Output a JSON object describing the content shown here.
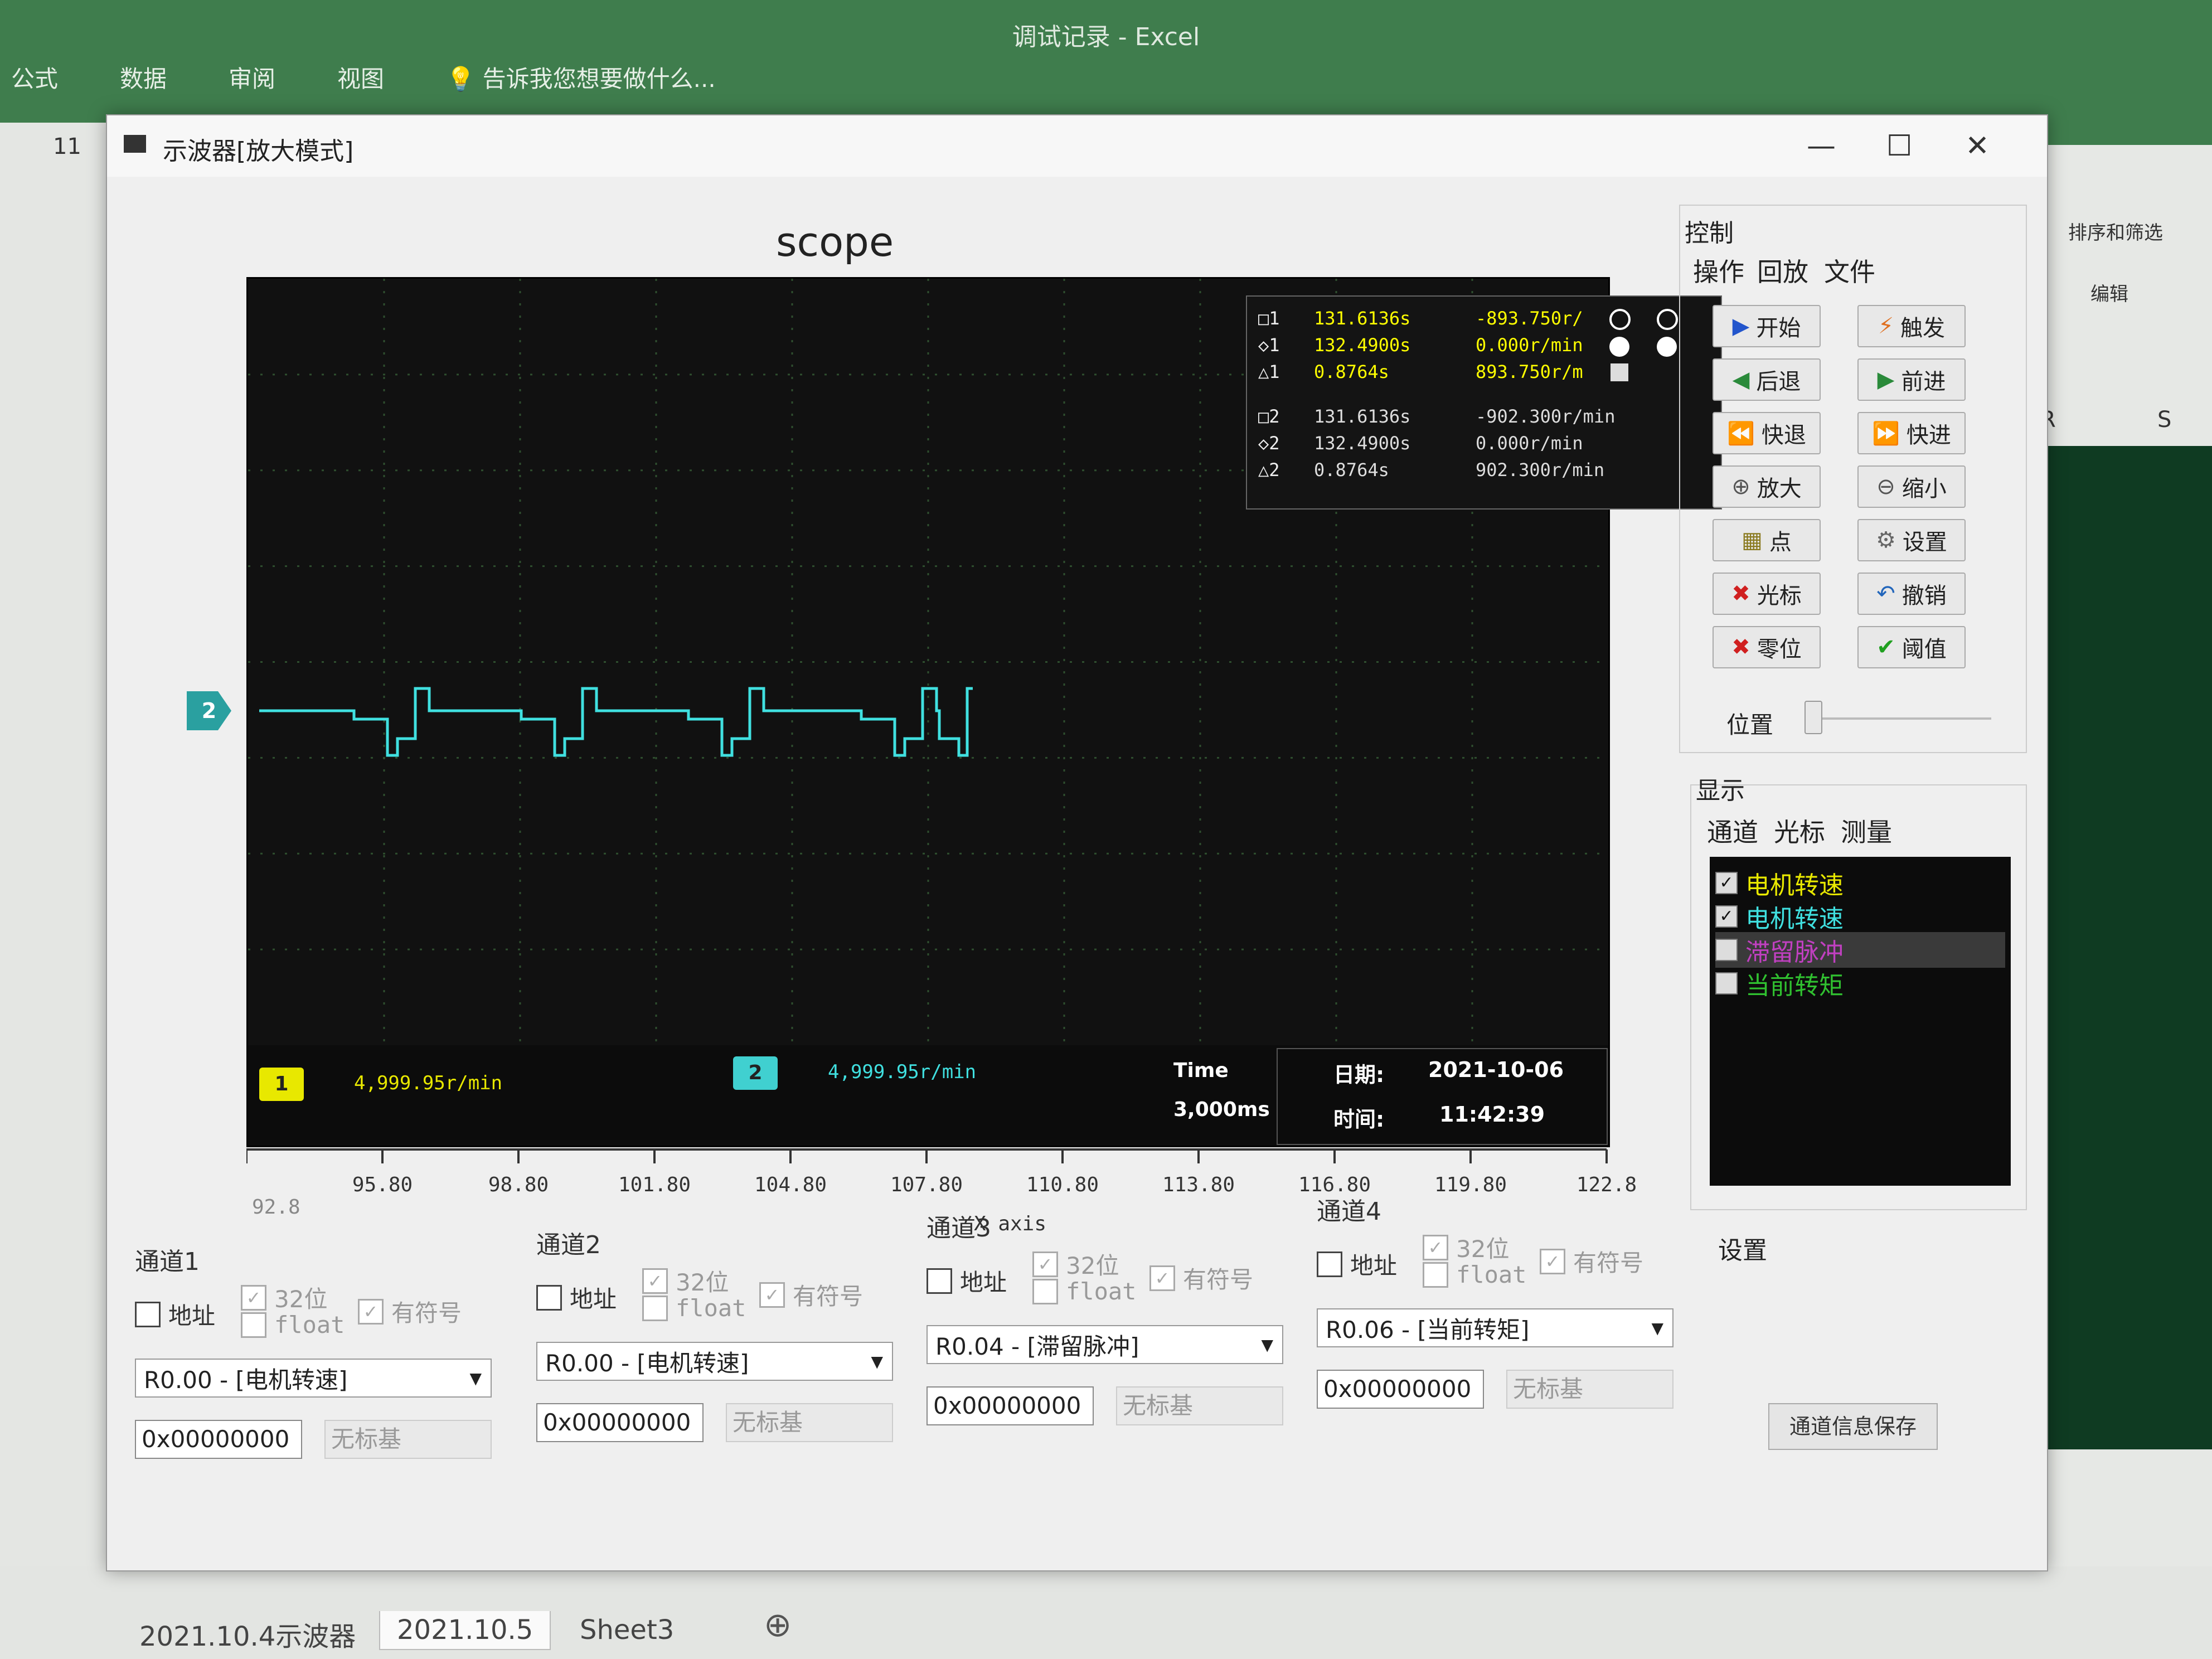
{
  "excel": {
    "title": "调试记录 - Excel",
    "ribbon_tabs": [
      "公式",
      "数据",
      "审阅",
      "视图"
    ],
    "tell_me": "告诉我您想要做什么...",
    "font_size": "11",
    "sort_filter": "排序和筛选",
    "edit_group": "编辑",
    "col_r": "R",
    "col_s": "S",
    "sheet_tabs": [
      "2021.10.4示波器",
      "2021.10.5",
      "Sheet3"
    ]
  },
  "window": {
    "title": "示波器[放大模式]",
    "minimize": "—",
    "maximize": "☐",
    "close": "✕"
  },
  "scope": {
    "title": "scope",
    "channel_marker": "2",
    "cursors": [
      {
        "sym": "□1",
        "t": "131.6136s",
        "v": "-893.750r/"
      },
      {
        "sym": "◇1",
        "t": "132.4900s",
        "v": "0.000r/min"
      },
      {
        "sym": "△1",
        "t": "0.8764s",
        "v": "893.750r/m"
      },
      {
        "sym": "□2",
        "t": "131.6136s",
        "v": "-902.300r/min"
      },
      {
        "sym": "◇2",
        "t": "132.4900s",
        "v": "0.000r/min"
      },
      {
        "sym": "△2",
        "t": "0.8764s",
        "v": "902.300r/min"
      }
    ],
    "status": {
      "ch1_badge": "1",
      "ch1_value": "4,999.95r/min",
      "ch2_badge": "2",
      "ch2_value": "4,999.95r/min",
      "time_label": "Time",
      "time_value": "3,000ms",
      "date_label": "日期:",
      "date_value": "2021-10-06",
      "clock_label": "时间:",
      "clock_value": "11:42:39"
    },
    "x_axis": {
      "title": "X axis",
      "ticks": [
        "92.8",
        "95.80",
        "98.80",
        "101.80",
        "104.80",
        "107.80",
        "110.80",
        "113.80",
        "116.80",
        "119.80",
        "122.8"
      ]
    }
  },
  "control": {
    "group_title": "控制",
    "tabs": [
      "操作",
      "回放",
      "文件"
    ],
    "buttons": [
      {
        "label": "开始",
        "icon": "play-icon",
        "glyph": "▶",
        "color": "#2255cc"
      },
      {
        "label": "触发",
        "icon": "trigger-icon",
        "glyph": "⚡",
        "color": "#e07020"
      },
      {
        "label": "后退",
        "icon": "back-icon",
        "glyph": "◀",
        "color": "#2a8a3a"
      },
      {
        "label": "前进",
        "icon": "forward-icon",
        "glyph": "▶",
        "color": "#2a8a3a"
      },
      {
        "label": "快退",
        "icon": "rewind-icon",
        "glyph": "⏪",
        "color": "#c8a020"
      },
      {
        "label": "快进",
        "icon": "fast-forward-icon",
        "glyph": "⏩",
        "color": "#c8a020"
      },
      {
        "label": "放大",
        "icon": "zoom-in-icon",
        "glyph": "⊕",
        "color": "#555"
      },
      {
        "label": "缩小",
        "icon": "zoom-out-icon",
        "glyph": "⊖",
        "color": "#555"
      },
      {
        "label": "点",
        "icon": "point-icon",
        "glyph": "▦",
        "color": "#8a7a20"
      },
      {
        "label": "设置",
        "icon": "settings-icon",
        "glyph": "⚙",
        "color": "#666"
      },
      {
        "label": "光标",
        "icon": "cursor-icon",
        "glyph": "✖",
        "color": "#d02020"
      },
      {
        "label": "撤销",
        "icon": "undo-icon",
        "glyph": "↶",
        "color": "#2266bb"
      },
      {
        "label": "零位",
        "icon": "zero-icon",
        "glyph": "✖",
        "color": "#d02020"
      },
      {
        "label": "阈值",
        "icon": "threshold-icon",
        "glyph": "✔",
        "color": "#20a020"
      }
    ],
    "position_label": "位置"
  },
  "display": {
    "group_title": "显示",
    "tabs": [
      "通道",
      "光标",
      "测量"
    ],
    "channels": [
      {
        "label": "电机转速",
        "checked": true,
        "color": "#e8e800"
      },
      {
        "label": "电机转速",
        "checked": true,
        "color": "#40e0e0"
      },
      {
        "label": "滞留脉冲",
        "checked": false,
        "color": "#c040c0"
      },
      {
        "label": "当前转矩",
        "checked": false,
        "color": "#30c030"
      }
    ]
  },
  "settings": {
    "group_title": "设置",
    "save_button": "通道信息保存"
  },
  "channel_config": [
    {
      "title": "通道1",
      "address": "地址",
      "bit32": "32位",
      "float": "float",
      "signed": "有符号",
      "register": "R0.00 - [电机转速]",
      "hex": "0x00000000",
      "unit": "无标基"
    },
    {
      "title": "通道2",
      "address": "地址",
      "bit32": "32位",
      "float": "float",
      "signed": "有符号",
      "register": "R0.00 - [电机转速]",
      "hex": "0x00000000",
      "unit": "无标基"
    },
    {
      "title": "通道3",
      "address": "地址",
      "bit32": "32位",
      "float": "float",
      "signed": "有符号",
      "register": "R0.04 - [滞留脉冲]",
      "hex": "0x00000000",
      "unit": "无标基"
    },
    {
      "title": "通道4",
      "address": "地址",
      "bit32": "32位",
      "float": "float",
      "signed": "有符号",
      "register": "R0.06 - [当前转矩]",
      "hex": "0x00000000",
      "unit": "无标基"
    }
  ],
  "colors": {
    "ch1": "#e8e800",
    "ch2": "#40e0e0",
    "grid": "#2f4f2f"
  }
}
